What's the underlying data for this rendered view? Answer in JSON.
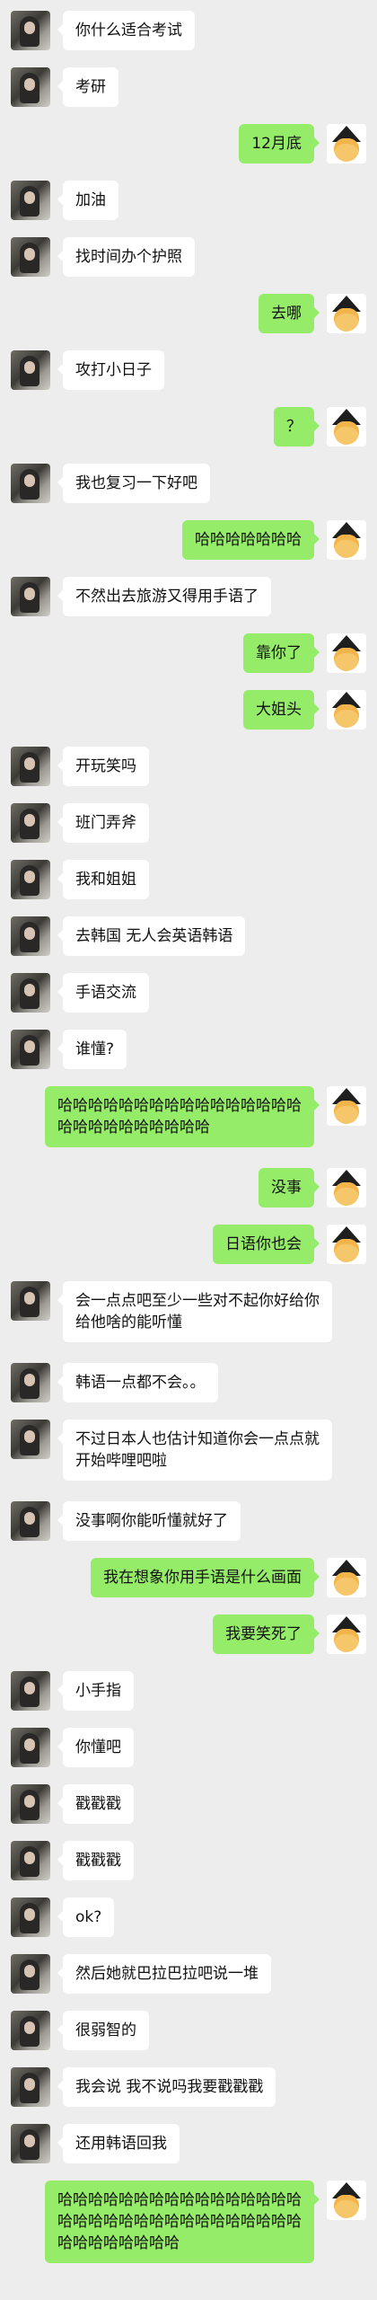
{
  "colors": {
    "background": "#ededed",
    "received_bubble": "#ffffff",
    "sent_bubble": "#95ec69",
    "text": "#111111"
  },
  "messages": [
    {
      "side": "left",
      "text": "你什么适合考试"
    },
    {
      "side": "left",
      "text": "考研"
    },
    {
      "side": "right",
      "text": "12月底"
    },
    {
      "side": "left",
      "text": "加油"
    },
    {
      "side": "left",
      "text": "找时间办个护照"
    },
    {
      "side": "right",
      "text": "去哪"
    },
    {
      "side": "left",
      "text": "攻打小日子"
    },
    {
      "side": "right",
      "text": "？"
    },
    {
      "side": "left",
      "text": "我也复习一下好吧"
    },
    {
      "side": "right",
      "text": "哈哈哈哈哈哈哈"
    },
    {
      "side": "left",
      "text": "不然出去旅游又得用手语了"
    },
    {
      "side": "right",
      "text": "靠你了"
    },
    {
      "side": "right",
      "text": "大姐头"
    },
    {
      "side": "left",
      "text": "开玩笑吗"
    },
    {
      "side": "left",
      "text": "班门弄斧"
    },
    {
      "side": "left",
      "text": "我和姐姐"
    },
    {
      "side": "left",
      "text": "去韩国 无人会英语韩语"
    },
    {
      "side": "left",
      "text": "手语交流"
    },
    {
      "side": "left",
      "text": "谁懂?"
    },
    {
      "side": "right",
      "text": "哈哈哈哈哈哈哈哈哈哈哈哈哈哈哈哈哈哈哈哈哈哈哈哈哈哈"
    },
    {
      "side": "right",
      "text": "没事"
    },
    {
      "side": "right",
      "text": "日语你也会"
    },
    {
      "side": "left",
      "text": "会一点点吧至少一些对不起你好给你给他啥的能听懂"
    },
    {
      "side": "left",
      "text": "韩语一点都不会。。"
    },
    {
      "side": "left",
      "text": "不过日本人也估计知道你会一点点就开始哔哩吧啦"
    },
    {
      "side": "left",
      "text": "没事啊你能听懂就好了"
    },
    {
      "side": "right",
      "text": "我在想象你用手语是什么画面"
    },
    {
      "side": "right",
      "text": "我要笑死了"
    },
    {
      "side": "left",
      "text": "小手指"
    },
    {
      "side": "left",
      "text": "你懂吧"
    },
    {
      "side": "left",
      "text": "戳戳戳"
    },
    {
      "side": "left",
      "text": "戳戳戳"
    },
    {
      "side": "left",
      "text": "ok?"
    },
    {
      "side": "left",
      "text": "然后她就巴拉巴拉吧说一堆"
    },
    {
      "side": "left",
      "text": "很弱智的"
    },
    {
      "side": "left",
      "text": "我会说 我不说吗我要戳戳戳"
    },
    {
      "side": "left",
      "text": "还用韩语回我"
    },
    {
      "side": "right",
      "text": "哈哈哈哈哈哈哈哈哈哈哈哈哈哈哈哈哈哈哈哈哈哈哈哈哈哈哈哈哈哈哈哈哈哈哈哈哈哈哈哈"
    }
  ]
}
